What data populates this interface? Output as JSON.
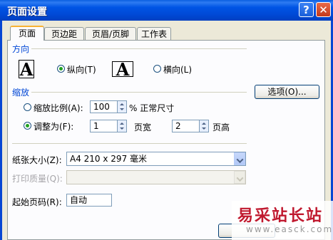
{
  "window": {
    "title": "页面设置",
    "help_glyph": "?",
    "close_glyph": "✕"
  },
  "tabs": [
    {
      "label": "页面",
      "active": true
    },
    {
      "label": "页边距",
      "active": false
    },
    {
      "label": "页眉/页脚",
      "active": false
    },
    {
      "label": "工作表",
      "active": false
    }
  ],
  "orientation": {
    "section_label": "方向",
    "portrait_label": "纵向(T)",
    "landscape_label": "横向(L)",
    "icon_letter": "A",
    "selected": "portrait"
  },
  "scaling": {
    "section_label": "缩放",
    "scale_label": "缩放比例(A):",
    "scale_value": "100",
    "scale_suffix": "% 正常尺寸",
    "fit_label": "调整为(F):",
    "fit_wide_value": "1",
    "fit_wide_suffix": "页宽",
    "fit_tall_value": "2",
    "fit_tall_suffix": "页高",
    "selected": "fit"
  },
  "options_button": "选项(O)...",
  "paper": {
    "paper_size_label": "纸张大小(Z):",
    "paper_size_value": "A4 210 x 297 毫米",
    "print_quality_label": "打印质量(Q):",
    "print_quality_value": ""
  },
  "first_page": {
    "label": "起始页码(R):",
    "value": "自动"
  },
  "watermark": {
    "text": "易采站长站",
    "url": "www.easck.com"
  }
}
